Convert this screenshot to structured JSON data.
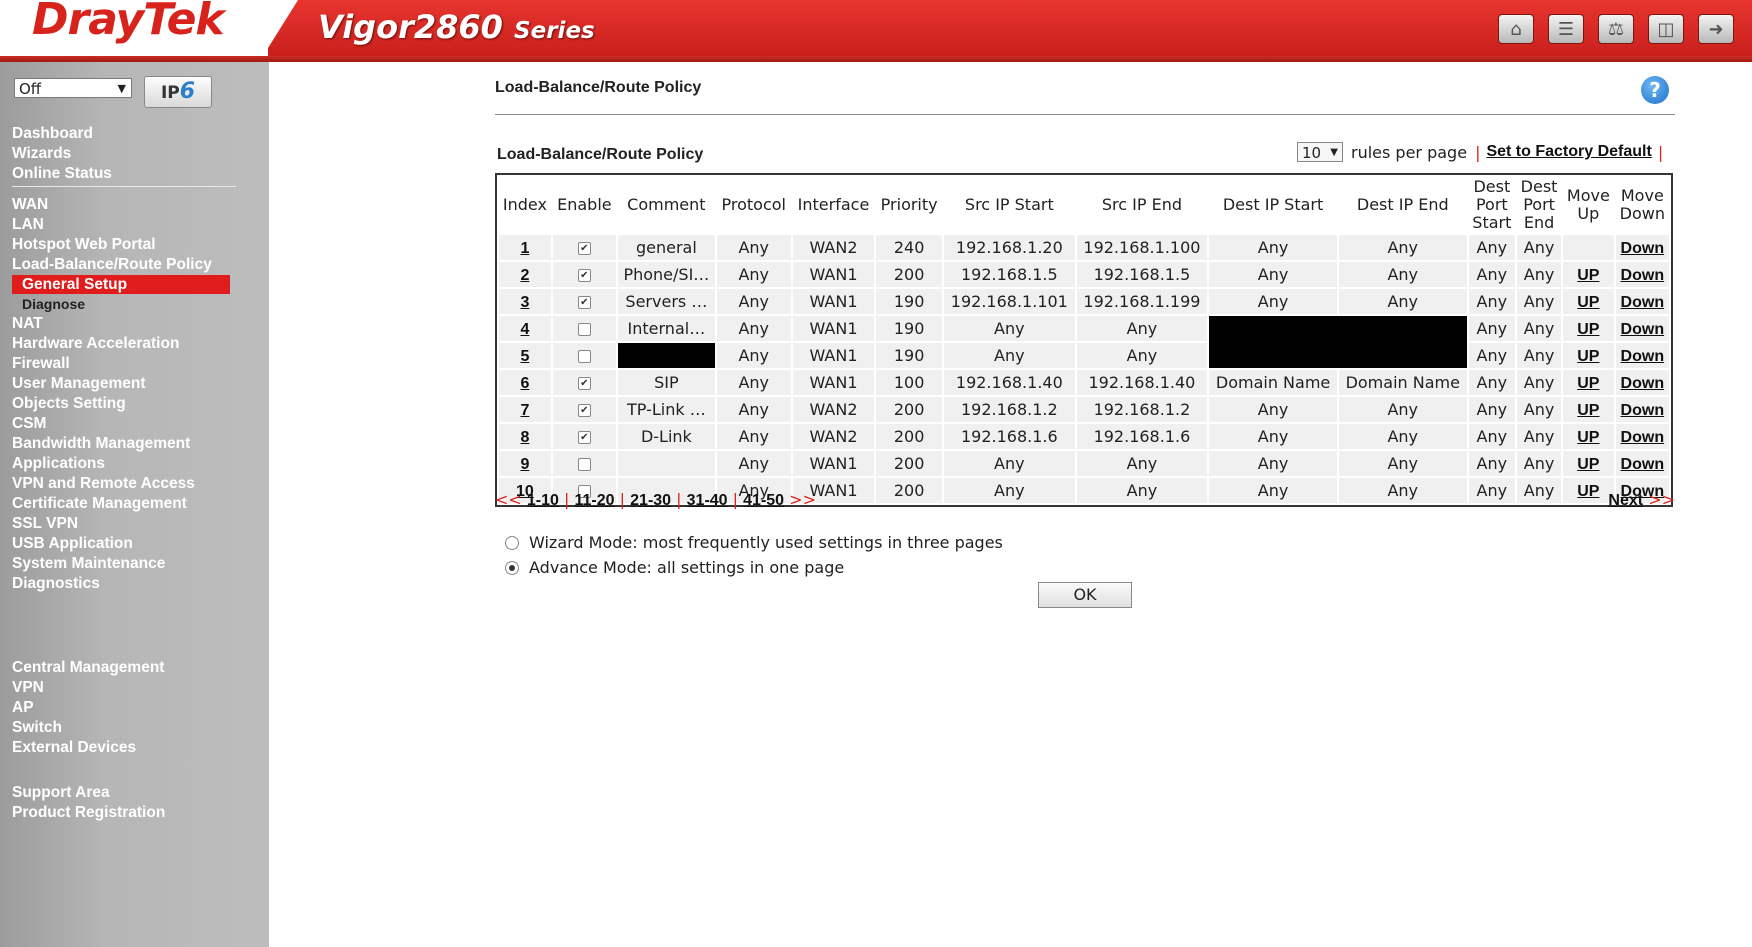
{
  "header": {
    "brand": "DrayTek",
    "model": "Vigor2860",
    "series": "Series",
    "icons": [
      "home-icon",
      "grid-icon",
      "sliders-icon",
      "save-icon",
      "logout-icon"
    ]
  },
  "sidebar": {
    "mode_select": "Off",
    "ipv6_label_a": "IP",
    "ipv6_label_b": "6",
    "group1": [
      "Dashboard",
      "Wizards",
      "Online Status"
    ],
    "group2": [
      "WAN",
      "LAN",
      "Hotspot Web Portal",
      "Load-Balance/Route Policy"
    ],
    "active_sub": "General Setup",
    "sub2": "Diagnose",
    "group3": [
      "NAT",
      "Hardware Acceleration",
      "Firewall",
      "User Management",
      "Objects Setting",
      "CSM",
      "Bandwidth Management",
      "Applications",
      "VPN and Remote Access",
      "Certificate Management",
      "SSL VPN",
      "USB Application",
      "System Maintenance",
      "Diagnostics"
    ],
    "group4": [
      "Central Management",
      "VPN",
      "AP",
      "Switch",
      "External Devices"
    ],
    "group5": [
      "Support Area",
      "Product Registration"
    ]
  },
  "main": {
    "page_title": "Load-Balance/Route Policy",
    "help_glyph": "?",
    "table_title": "Load-Balance/Route Policy",
    "rules_per_page_value": "10",
    "rules_per_page_label": "rules per page",
    "factory_default": "Set to Factory Default",
    "columns": {
      "index": "Index",
      "enable": "Enable",
      "comment": "Comment",
      "protocol": "Protocol",
      "interface": "Interface",
      "priority": "Priority",
      "src_start": "Src IP Start",
      "src_end": "Src IP End",
      "dst_start": "Dest IP Start",
      "dst_end": "Dest IP End",
      "dport_start_a": "Dest",
      "dport_start_b": "Port",
      "dport_start_c": "Start",
      "dport_end_a": "Dest",
      "dport_end_b": "Port",
      "dport_end_c": "End",
      "up_a": "Move",
      "up_b": "Up",
      "down_a": "Move",
      "down_b": "Down"
    },
    "rows": [
      {
        "idx": "1",
        "en": true,
        "comment": "general",
        "proto": "Any",
        "iface": "WAN2",
        "prio": "240",
        "ss": "192.168.1.20",
        "se": "192.168.1.100",
        "ds": "Any",
        "de": "Any",
        "ps": "Any",
        "pe": "Any",
        "up": "",
        "down": "Down"
      },
      {
        "idx": "2",
        "en": true,
        "comment": "Phone/SI…",
        "proto": "Any",
        "iface": "WAN1",
        "prio": "200",
        "ss": "192.168.1.5",
        "se": "192.168.1.5",
        "ds": "Any",
        "de": "Any",
        "ps": "Any",
        "pe": "Any",
        "up": "UP",
        "down": "Down"
      },
      {
        "idx": "3",
        "en": true,
        "comment": "Servers …",
        "proto": "Any",
        "iface": "WAN1",
        "prio": "190",
        "ss": "192.168.1.101",
        "se": "192.168.1.199",
        "ds": "Any",
        "de": "Any",
        "ps": "Any",
        "pe": "Any",
        "up": "UP",
        "down": "Down"
      },
      {
        "idx": "4",
        "en": false,
        "comment": "Internal…",
        "proto": "Any",
        "iface": "WAN1",
        "prio": "190",
        "ss": "Any",
        "se": "Any",
        "ds": "",
        "de": "",
        "ps": "Any",
        "pe": "Any",
        "up": "UP",
        "down": "Down"
      },
      {
        "idx": "5",
        "en": false,
        "comment": "",
        "proto": "Any",
        "iface": "WAN1",
        "prio": "190",
        "ss": "Any",
        "se": "Any",
        "ds": "",
        "de": "",
        "ps": "Any",
        "pe": "Any",
        "up": "UP",
        "down": "Down"
      },
      {
        "idx": "6",
        "en": true,
        "comment": "SIP",
        "proto": "Any",
        "iface": "WAN1",
        "prio": "100",
        "ss": "192.168.1.40",
        "se": "192.168.1.40",
        "ds": "Domain Name",
        "de": "Domain Name",
        "ps": "Any",
        "pe": "Any",
        "up": "UP",
        "down": "Down"
      },
      {
        "idx": "7",
        "en": true,
        "comment": "TP-Link …",
        "proto": "Any",
        "iface": "WAN2",
        "prio": "200",
        "ss": "192.168.1.2",
        "se": "192.168.1.2",
        "ds": "Any",
        "de": "Any",
        "ps": "Any",
        "pe": "Any",
        "up": "UP",
        "down": "Down"
      },
      {
        "idx": "8",
        "en": true,
        "comment": "D-Link",
        "proto": "Any",
        "iface": "WAN2",
        "prio": "200",
        "ss": "192.168.1.6",
        "se": "192.168.1.6",
        "ds": "Any",
        "de": "Any",
        "ps": "Any",
        "pe": "Any",
        "up": "UP",
        "down": "Down"
      },
      {
        "idx": "9",
        "en": false,
        "comment": "",
        "proto": "Any",
        "iface": "WAN1",
        "prio": "200",
        "ss": "Any",
        "se": "Any",
        "ds": "Any",
        "de": "Any",
        "ps": "Any",
        "pe": "Any",
        "up": "UP",
        "down": "Down"
      },
      {
        "idx": "10",
        "en": false,
        "comment": "",
        "proto": "Any",
        "iface": "WAN1",
        "prio": "200",
        "ss": "Any",
        "se": "Any",
        "ds": "Any",
        "de": "Any",
        "ps": "Any",
        "pe": "Any",
        "up": "UP",
        "down": "Down"
      }
    ],
    "pager": {
      "prev": "<<",
      "pages": [
        "1-10",
        "11-20",
        "21-30",
        "31-40",
        "41-50"
      ],
      "after": ">>",
      "next_label": "Next",
      "next_arrows": ">>"
    },
    "wizard_mode": "Wizard Mode: most frequently used settings in three pages",
    "advance_mode": "Advance Mode: all settings in one page",
    "ok_label": "OK"
  }
}
